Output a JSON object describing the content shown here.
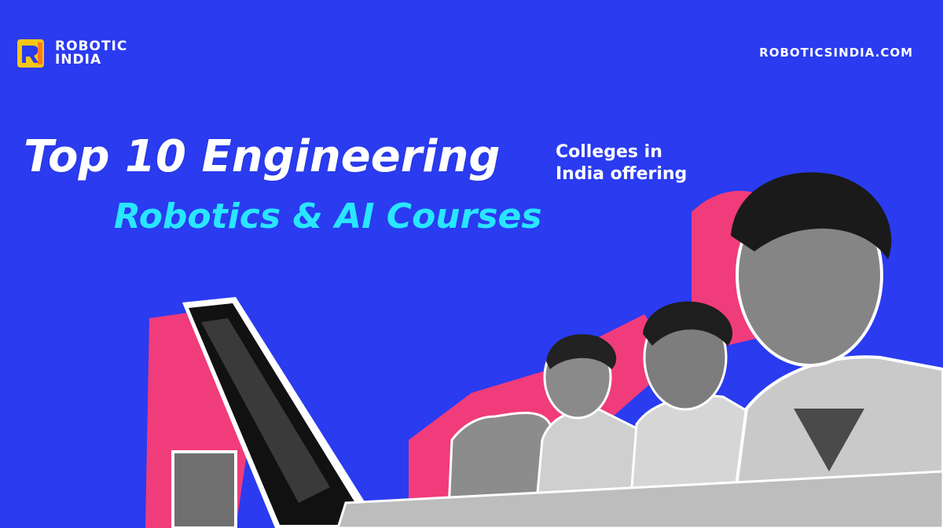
{
  "brand": {
    "logo_line1": "ROBOTIC",
    "logo_line2": "INDIA",
    "tagline": "ROBOTICSINDIA.COM"
  },
  "headline": {
    "line1": "Top 10 Engineering",
    "side_line1": "Colleges in",
    "side_line2": "India offering",
    "line2": "Robotics & AI Courses"
  },
  "colors": {
    "background": "#2a3bf0",
    "accent_cyan": "#29e6ff",
    "accent_pink": "#f03c7a",
    "logo_yellow": "#f5c518"
  },
  "image": {
    "subject": "students-at-computers-photo"
  }
}
